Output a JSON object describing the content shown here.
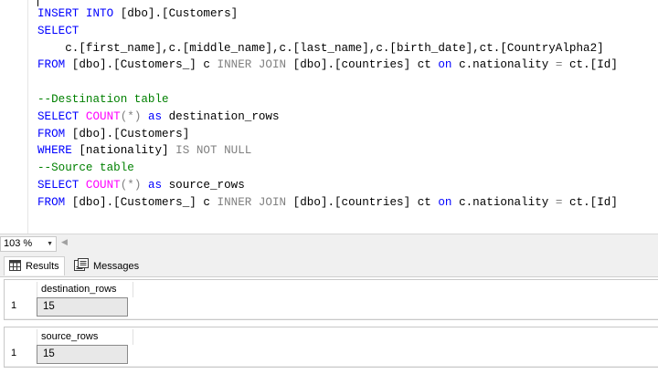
{
  "editor": {
    "lines": [
      [
        {
          "c": "kw",
          "t": "INSERT INTO "
        },
        {
          "c": "tx",
          "t": "[dbo].[Customers]"
        }
      ],
      [
        {
          "c": "kw",
          "t": "SELECT"
        }
      ],
      [
        {
          "c": "tx",
          "t": "    c.[first_name],c.[middle_name],c.[last_name],c.[birth_date],ct.[CountryAlpha2]"
        }
      ],
      [
        {
          "c": "kw",
          "t": "FROM "
        },
        {
          "c": "tx",
          "t": "[dbo].[Customers_] c "
        },
        {
          "c": "gr",
          "t": "INNER JOIN "
        },
        {
          "c": "tx",
          "t": "[dbo].[countries] ct "
        },
        {
          "c": "kw",
          "t": "on "
        },
        {
          "c": "tx",
          "t": "c.nationality "
        },
        {
          "c": "gr",
          "t": "= "
        },
        {
          "c": "tx",
          "t": "ct.[Id]"
        }
      ],
      [
        {
          "c": "tx",
          "t": ""
        }
      ],
      [
        {
          "c": "cm",
          "t": "--Destination table"
        }
      ],
      [
        {
          "c": "kw",
          "t": "SELECT "
        },
        {
          "c": "fn",
          "t": "COUNT"
        },
        {
          "c": "gr",
          "t": "(*) "
        },
        {
          "c": "kw",
          "t": "as "
        },
        {
          "c": "tx",
          "t": "destination_rows"
        }
      ],
      [
        {
          "c": "kw",
          "t": "FROM "
        },
        {
          "c": "tx",
          "t": "[dbo].[Customers]"
        }
      ],
      [
        {
          "c": "kw",
          "t": "WHERE "
        },
        {
          "c": "tx",
          "t": "[nationality] "
        },
        {
          "c": "gr",
          "t": "IS NOT NULL"
        }
      ],
      [
        {
          "c": "cm",
          "t": "--Source table"
        }
      ],
      [
        {
          "c": "kw",
          "t": "SELECT "
        },
        {
          "c": "fn",
          "t": "COUNT"
        },
        {
          "c": "gr",
          "t": "(*) "
        },
        {
          "c": "kw",
          "t": "as "
        },
        {
          "c": "tx",
          "t": "source_rows"
        }
      ],
      [
        {
          "c": "kw",
          "t": "FROM "
        },
        {
          "c": "tx",
          "t": "[dbo].[Customers_] c "
        },
        {
          "c": "gr",
          "t": "INNER JOIN "
        },
        {
          "c": "tx",
          "t": "[dbo].[countries] ct "
        },
        {
          "c": "kw",
          "t": "on "
        },
        {
          "c": "tx",
          "t": "c.nationality "
        },
        {
          "c": "gr",
          "t": "= "
        },
        {
          "c": "tx",
          "t": "ct.[Id]"
        }
      ]
    ]
  },
  "zoom": {
    "value": "103 %"
  },
  "tabs": {
    "results": "Results",
    "messages": "Messages"
  },
  "results": [
    {
      "column": "destination_rows",
      "row_number": "1",
      "value": "15"
    },
    {
      "column": "source_rows",
      "row_number": "1",
      "value": "15"
    }
  ],
  "colors": {
    "keyword": "#0000ff",
    "function": "#ff00ff",
    "operator": "#808080",
    "comment": "#008000",
    "text": "#000000"
  },
  "icons": {
    "results_tab": "grid-icon",
    "messages_tab": "messages-icon",
    "zoom_dropdown": "chevron-down-icon",
    "scroll_left": "chevron-left-icon"
  }
}
